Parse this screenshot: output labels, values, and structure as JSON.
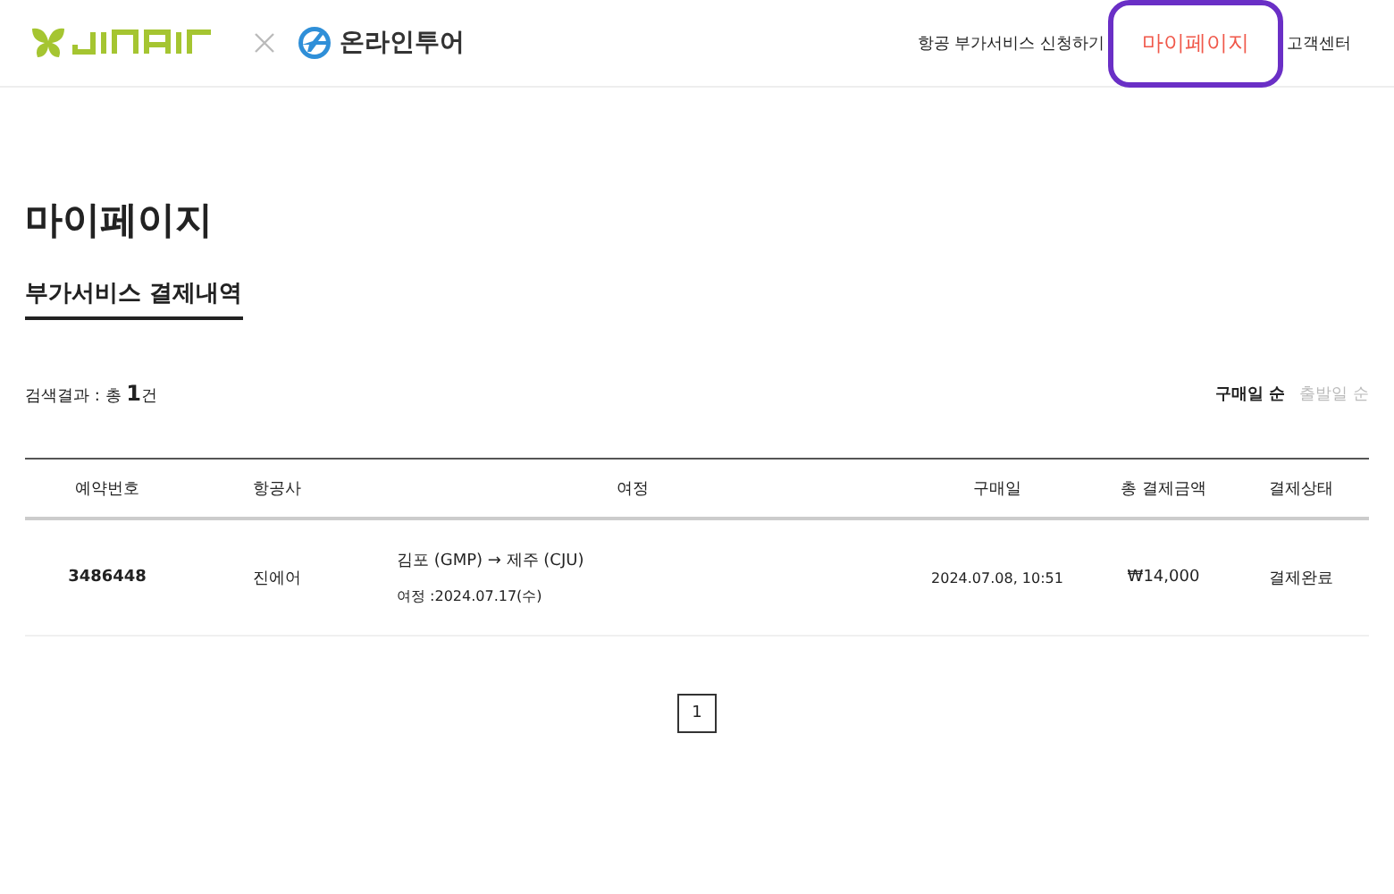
{
  "header": {
    "partner_logo_text": "온라인투어",
    "nav": [
      {
        "label": "항공 부가서비스 신청하기",
        "selected": false
      },
      {
        "label": "마이페이지",
        "selected": true
      },
      {
        "label": "고객센터",
        "selected": false
      }
    ]
  },
  "page_title": "마이페이지",
  "section_tab": {
    "label": "부가서비스 결제내역",
    "selected": true
  },
  "result_count": "검색결과 : 총 **1**건",
  "sort_options": [
    {
      "label": "구매일 순",
      "selected": true
    },
    {
      "label": "출발일 순",
      "selected": false
    }
  ],
  "table": {
    "columns": [
      "예약번호",
      "항공사",
      "여정",
      "구매일",
      "총 결제금액",
      "결제상태"
    ],
    "rows": [
      {
        "booking_no": "3486448",
        "airline": "진에어",
        "route": "김포 (GMP) → 제주 (CJU)",
        "travel_date": "여정 :2024.07.17(수)",
        "purchase_date": "2024.07.08, 10:51",
        "amount": "₩14,000",
        "status": "결제완료"
      }
    ]
  },
  "pagination": [
    {
      "label": "1",
      "selected": true
    }
  ]
}
